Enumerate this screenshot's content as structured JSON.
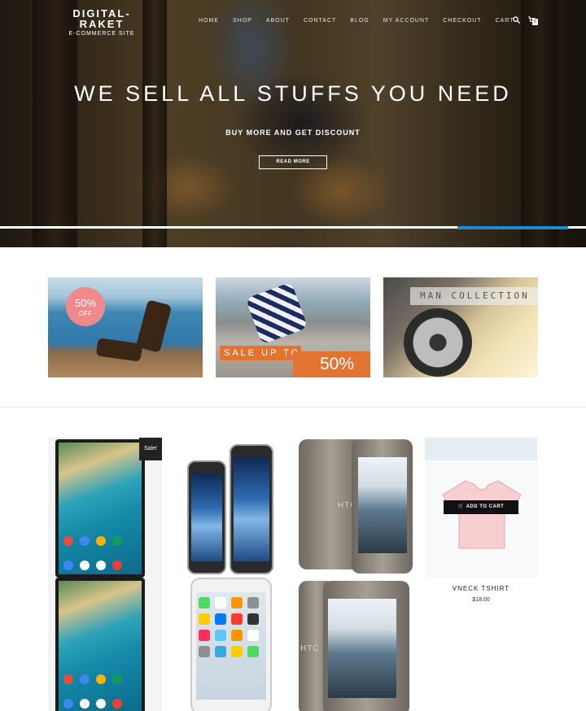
{
  "logo": {
    "line1": "DIGITAL-",
    "line2": "RAKET",
    "tagline": "E-COMMERCE SITE"
  },
  "nav": {
    "items": [
      "HOME",
      "SHOP",
      "ABOUT",
      "CONTACT",
      "BLOG",
      "MY ACCOUNT",
      "CHECKOUT",
      "CART"
    ]
  },
  "header_icons": {
    "search": "search-icon",
    "cart": "cart-icon",
    "cart_count": "0"
  },
  "hero": {
    "title": "WE SELL ALL STUFFS YOU NEED",
    "subtitle": "BUY MORE AND GET DISCOUNT",
    "button_label": "READ MORE",
    "slider_progress": 0.19
  },
  "banners": {
    "discount": {
      "percent": "50%",
      "off": "OFF"
    },
    "sale": {
      "text": "SALE UP TO",
      "percent": "50%"
    },
    "collection": {
      "label": "MAN COLLECTION"
    }
  },
  "products": {
    "sale_badge": "Sale!",
    "featured": {
      "name": "VNECK TSHIRT",
      "price": "$18.00",
      "button_label": "ADD TO CART",
      "cart_icon": "cart-icon"
    },
    "phone_brand": "HTC"
  },
  "colors": {
    "accent_blue": "#1e8ad2",
    "sale_orange": "#e27432",
    "badge_pink": "#f0898b"
  }
}
